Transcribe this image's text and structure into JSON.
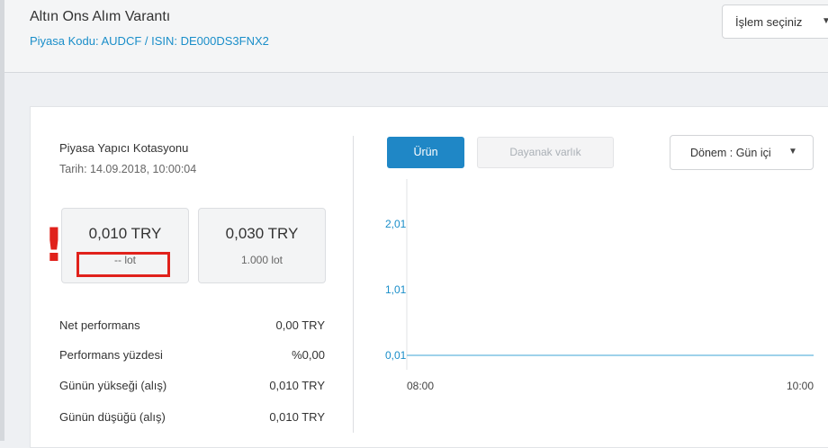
{
  "header": {
    "title": "Altın Ons Alım Varantı",
    "subtitle": "Piyasa Kodu: AUDCF / ISIN: DE000DS3FNX2",
    "action_label": "İşlem seçiniz"
  },
  "quote_panel": {
    "title": "Piyasa Yapıcı Kotasyonu",
    "date": "Tarih: 14.09.2018, 10:00:04",
    "bid": {
      "price": "0,010 TRY",
      "lot": "-- lot"
    },
    "ask": {
      "price": "0,030 TRY",
      "lot": "1.000 lot"
    },
    "alert_mark": "!"
  },
  "stats": [
    {
      "label": "Net performans",
      "value": "0,00 TRY"
    },
    {
      "label": "Performans yüzdesi",
      "value": "%0,00"
    },
    {
      "label": "Günün yükseği (alış)",
      "value": "0,010 TRY"
    },
    {
      "label": "Günün düşüğü (alış)",
      "value": "0,010 TRY"
    }
  ],
  "chart_controls": {
    "product_label": "Ürün",
    "underlying_label": "Dayanak varlık",
    "period_label": "Dönem : Gün içi"
  },
  "colors": {
    "accent": "#1f87c6",
    "link": "#1a8ec9",
    "alert": "#e0211b",
    "series": "#7fc3e4"
  },
  "icons": {
    "dropdown": "chevron-down-icon",
    "alert": "exclamation-icon"
  },
  "chart_data": {
    "type": "line",
    "title": "",
    "xlabel": "",
    "ylabel": "",
    "x_ticks": [
      "08:00",
      "10:00"
    ],
    "y_ticks": [
      "2,01",
      "1,01",
      "0,01"
    ],
    "ylim": [
      0.01,
      2.01
    ],
    "grid": false,
    "series": [
      {
        "x": [
          "08:00",
          "10:00"
        ],
        "values": [
          0.01,
          0.01
        ]
      }
    ]
  }
}
